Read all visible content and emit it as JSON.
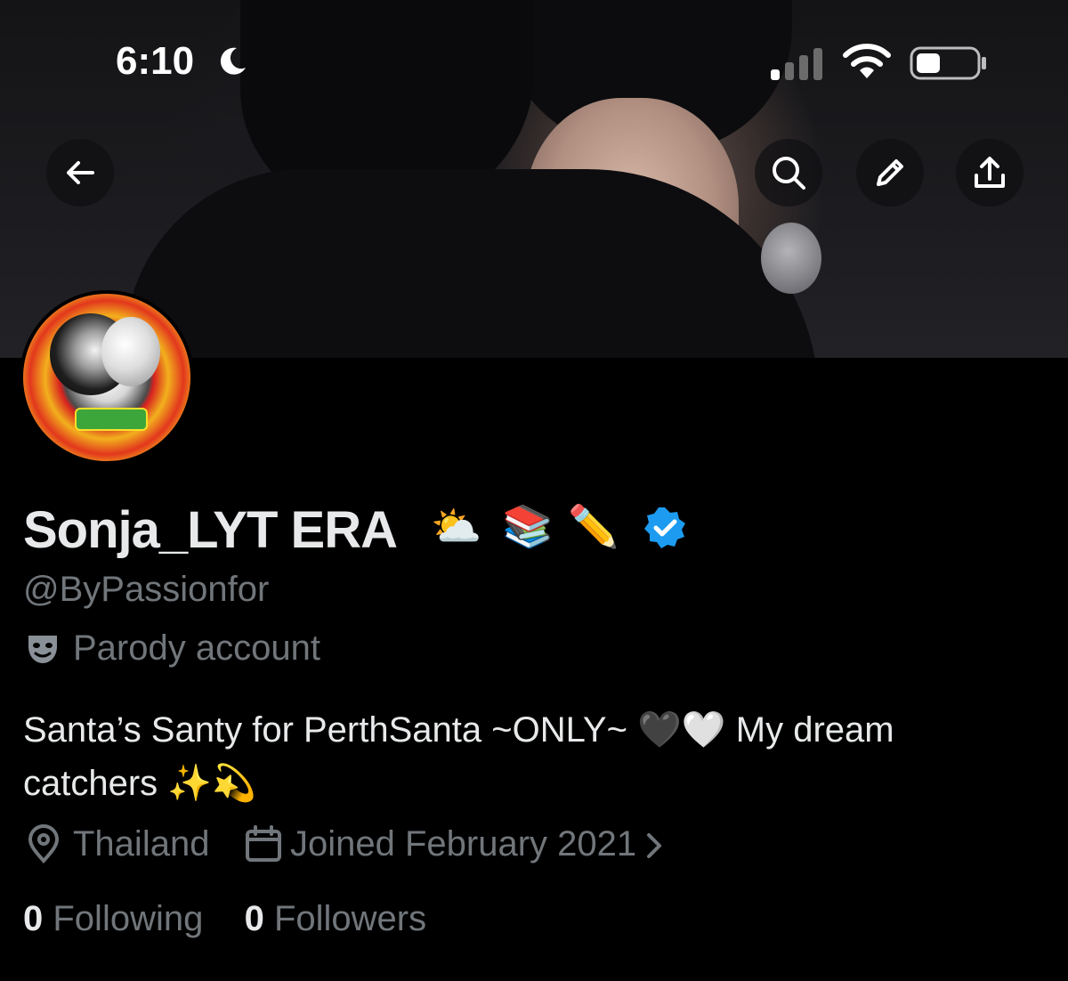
{
  "status_bar": {
    "time": "6:10"
  },
  "profile": {
    "display_name": "Sonja_LYT ERA",
    "name_emojis": [
      "⛅",
      "📚",
      "✏️"
    ],
    "handle": "@ByPassionfor",
    "label": "Parody account",
    "bio_line1": "Santa’s Santy for PerthSanta ~ONLY~ 🖤🤍 My dream",
    "bio_line2": "catchers ✨💫",
    "location": "Thailand",
    "joined": "Joined February 2021",
    "following_count": "0",
    "following_label": "Following",
    "followers_count": "0",
    "followers_label": "Followers"
  },
  "colors": {
    "background": "#000000",
    "primary_text": "#e7e9ea",
    "secondary_text": "#71767b",
    "verified_blue": "#1d9bf0"
  },
  "icons": {
    "back": "arrow-left-icon",
    "search": "search-icon",
    "edit": "pencil-icon",
    "share": "share-icon",
    "verified": "verified-badge-icon",
    "parody": "mask-icon",
    "location": "location-pin-icon",
    "calendar": "calendar-icon"
  }
}
